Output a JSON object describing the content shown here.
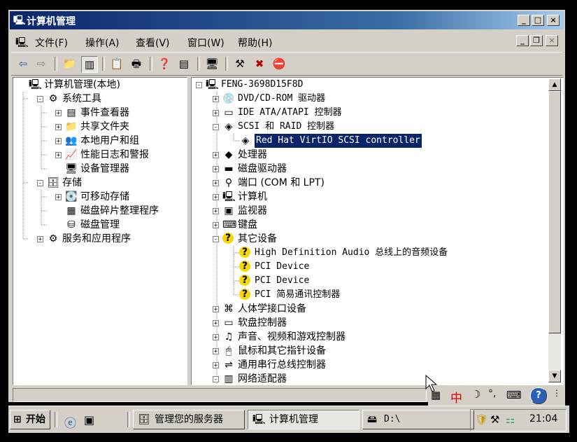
{
  "window": {
    "title": "计算机管理",
    "controls": {
      "minimize": "_",
      "maximize": "□",
      "close": "×"
    },
    "child_controls": {
      "minimize": "_",
      "restore": "❐",
      "close": "×"
    }
  },
  "menu": [
    "文件(F)",
    "操作(A)",
    "查看(V)",
    "窗口(W)",
    "帮助(H)"
  ],
  "toolbar": {
    "icons": [
      "back-arrow-icon",
      "forward-arrow-icon",
      "up-folder-icon",
      "show-tree-icon",
      "properties-icon",
      "print-icon",
      "help-icon",
      "export-list-icon",
      "scan-hardware-icon",
      "update-driver-icon",
      "uninstall-icon",
      "disable-device-icon"
    ]
  },
  "left_tree": [
    {
      "label": "计算机管理(本地)",
      "level": 0,
      "expander": "",
      "icon": "computer-icon"
    },
    {
      "label": "系统工具",
      "level": 1,
      "expander": "-",
      "icon": "tools-icon"
    },
    {
      "label": "事件查看器",
      "level": 2,
      "expander": "+",
      "icon": "event-viewer-icon"
    },
    {
      "label": "共享文件夹",
      "level": 2,
      "expander": "+",
      "icon": "shared-folder-icon"
    },
    {
      "label": "本地用户和组",
      "level": 2,
      "expander": "+",
      "icon": "users-icon"
    },
    {
      "label": "性能日志和警报",
      "level": 2,
      "expander": "+",
      "icon": "performance-icon"
    },
    {
      "label": "设备管理器",
      "level": 2,
      "expander": "",
      "icon": "device-manager-icon"
    },
    {
      "label": "存储",
      "level": 1,
      "expander": "-",
      "icon": "storage-icon"
    },
    {
      "label": "可移动存储",
      "level": 2,
      "expander": "+",
      "icon": "removable-storage-icon"
    },
    {
      "label": "磁盘碎片整理程序",
      "level": 2,
      "expander": "",
      "icon": "defrag-icon"
    },
    {
      "label": "磁盘管理",
      "level": 2,
      "expander": "",
      "icon": "disk-management-icon"
    },
    {
      "label": "服务和应用程序",
      "level": 1,
      "expander": "+",
      "icon": "services-icon"
    }
  ],
  "right_tree": [
    {
      "label": "FENG-3698D15F8D",
      "level": 0,
      "expander": "-",
      "icon": "computer-icon",
      "selected": false
    },
    {
      "label": "DVD/CD-ROM 驱动器",
      "level": 1,
      "expander": "+",
      "icon": "cdrom-icon",
      "selected": false
    },
    {
      "label": "IDE ATA/ATAPI 控制器",
      "level": 1,
      "expander": "+",
      "icon": "ide-controller-icon",
      "selected": false
    },
    {
      "label": "SCSI 和 RAID 控制器",
      "level": 1,
      "expander": "-",
      "icon": "scsi-icon",
      "selected": false
    },
    {
      "label": "Red Hat VirtIO SCSI controller",
      "level": 2,
      "expander": "",
      "icon": "scsi-icon",
      "selected": true
    },
    {
      "label": "处理器",
      "level": 1,
      "expander": "+",
      "icon": "processor-icon",
      "selected": false
    },
    {
      "label": "磁盘驱动器",
      "level": 1,
      "expander": "+",
      "icon": "disk-drive-icon",
      "selected": false
    },
    {
      "label": "端口 (COM 和 LPT)",
      "level": 1,
      "expander": "+",
      "icon": "port-icon",
      "selected": false
    },
    {
      "label": "计算机",
      "level": 1,
      "expander": "+",
      "icon": "computer-icon",
      "selected": false
    },
    {
      "label": "监视器",
      "level": 1,
      "expander": "+",
      "icon": "monitor-icon",
      "selected": false
    },
    {
      "label": "键盘",
      "level": 1,
      "expander": "+",
      "icon": "keyboard-icon",
      "selected": false
    },
    {
      "label": "其它设备",
      "level": 1,
      "expander": "-",
      "icon": "unknown-device-icon",
      "selected": false
    },
    {
      "label": "High Definition Audio 总线上的音频设备",
      "level": 2,
      "expander": "",
      "icon": "unknown-device-icon",
      "selected": false
    },
    {
      "label": "PCI Device",
      "level": 2,
      "expander": "",
      "icon": "unknown-device-icon",
      "selected": false
    },
    {
      "label": "PCI Device",
      "level": 2,
      "expander": "",
      "icon": "unknown-device-icon",
      "selected": false
    },
    {
      "label": "PCI 简易通讯控制器",
      "level": 2,
      "expander": "",
      "icon": "unknown-device-icon",
      "selected": false
    },
    {
      "label": "人体学接口设备",
      "level": 1,
      "expander": "+",
      "icon": "hid-icon",
      "selected": false
    },
    {
      "label": "软盘控制器",
      "level": 1,
      "expander": "+",
      "icon": "floppy-controller-icon",
      "selected": false
    },
    {
      "label": "声音、视频和游戏控制器",
      "level": 1,
      "expander": "+",
      "icon": "sound-icon",
      "selected": false
    },
    {
      "label": "鼠标和其它指针设备",
      "level": 1,
      "expander": "+",
      "icon": "mouse-icon",
      "selected": false
    },
    {
      "label": "通用串行总线控制器",
      "level": 1,
      "expander": "+",
      "icon": "usb-icon",
      "selected": false
    },
    {
      "label": "网络适配器",
      "level": 1,
      "expander": "-",
      "icon": "network-adapter-icon",
      "selected": false
    }
  ],
  "language_bar": {
    "lang": "中",
    "glyphs": [
      "☽",
      "°,"
    ]
  },
  "taskbar": {
    "start_label": "开始",
    "quick_launch": [
      "ie-icon",
      "desktop-icon"
    ],
    "tasks": [
      {
        "label": "管理您的服务器",
        "icon": "server-manager-icon",
        "active": false
      },
      {
        "label": "计算机管理",
        "icon": "computer-management-icon",
        "active": true
      },
      {
        "label": "D:\\",
        "icon": "drive-icon",
        "active": false
      }
    ],
    "tray_icons": [
      "shield-icon",
      "tools-icon",
      "network-icon"
    ],
    "clock": "21:04"
  }
}
